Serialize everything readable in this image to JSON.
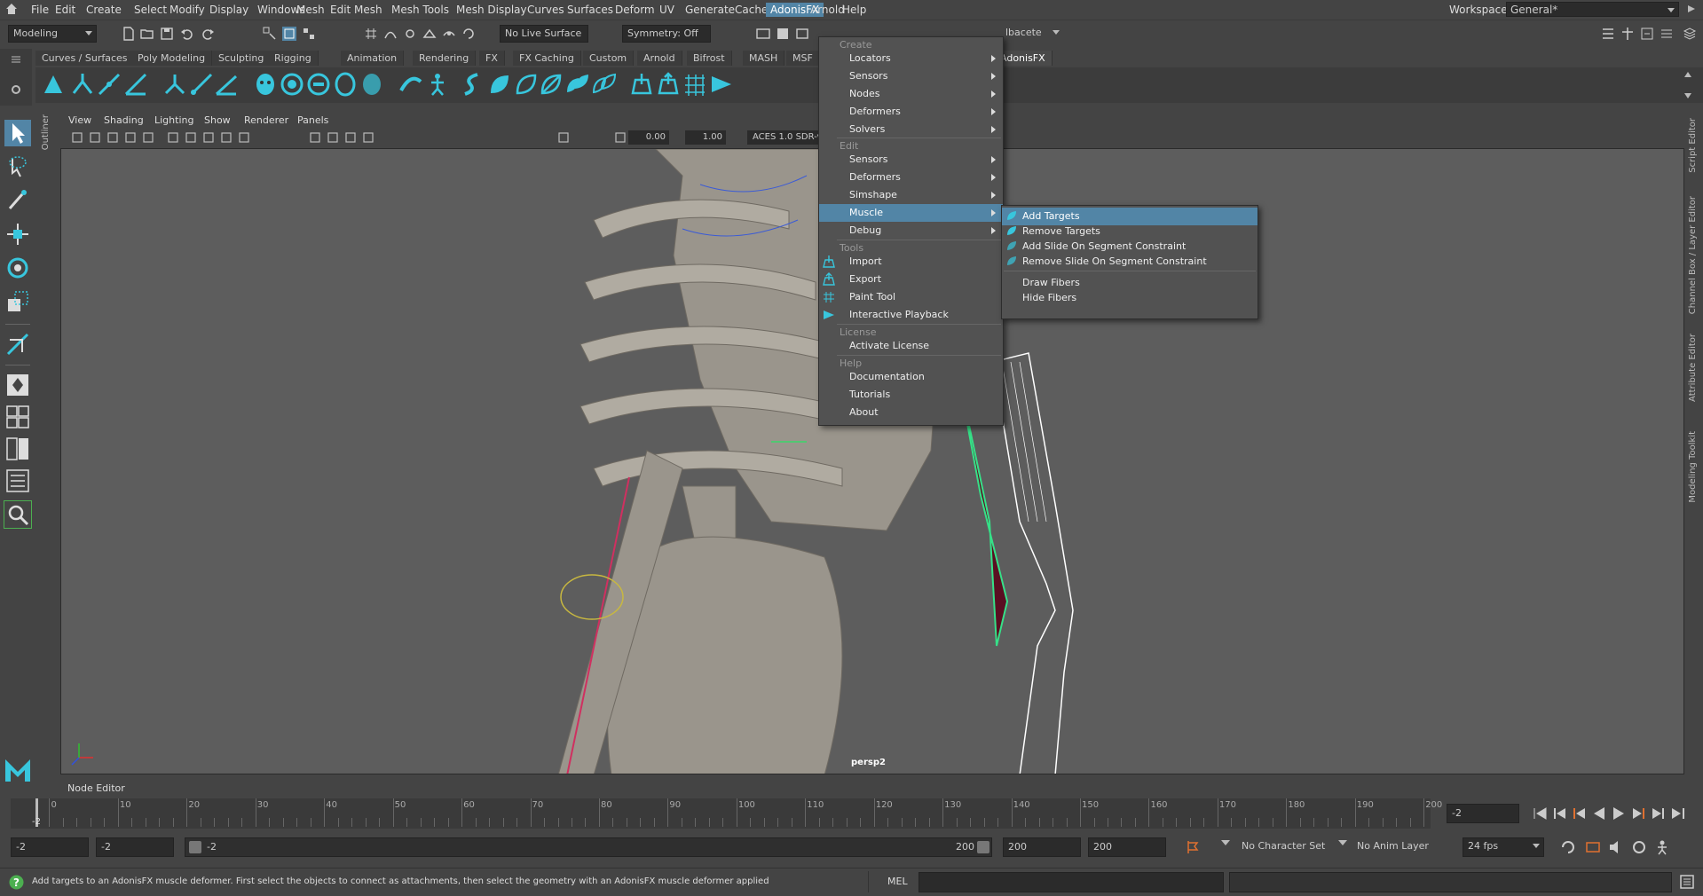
{
  "menubar": {
    "items": [
      "File",
      "Edit",
      "Create",
      "Select",
      "Modify",
      "Display",
      "Windows",
      "Mesh",
      "Edit Mesh",
      "Mesh Tools",
      "Mesh Display",
      "Curves",
      "Surfaces",
      "Deform",
      "UV",
      "Generate",
      "Cache",
      "AdonisFX",
      "Arnold",
      "Help"
    ],
    "active": "AdonisFX",
    "workspace_label": "Workspace:",
    "workspace_value": "General*"
  },
  "statusline": {
    "mode": "Modeling",
    "live_surface": "No Live Surface",
    "symmetry": "Symmetry: Off",
    "partial_field": "lbacete"
  },
  "shelf": {
    "tabs": [
      "Curves / Surfaces",
      "Poly Modeling",
      "Sculpting",
      "Rigging",
      "Animation",
      "Rendering",
      "FX",
      "FX Caching",
      "Custom",
      "Arnold",
      "Bifrost",
      "MASH",
      "MSF",
      "AdonisFX"
    ],
    "active_tab": "AdonisFX"
  },
  "outliner_label": "Outliner",
  "panel": {
    "menus": [
      "View",
      "Shading",
      "Lighting",
      "Show",
      "Renderer",
      "Panels"
    ],
    "exposure": "0.00",
    "gamma": "1.00",
    "colorspace": "ACES 1.0 SDR-v",
    "camera": "persp2"
  },
  "adonis_menu": {
    "sections": {
      "create": "Create",
      "edit": "Edit",
      "tools": "Tools",
      "license": "License",
      "help": "Help"
    },
    "create_items": [
      "Locators",
      "Sensors",
      "Nodes",
      "Deformers",
      "Solvers"
    ],
    "edit_items": [
      "Sensors",
      "Deformers",
      "Simshape",
      "Muscle",
      "Debug"
    ],
    "tools_items": [
      "Import",
      "Export",
      "Paint Tool",
      "Interactive Playback"
    ],
    "license_items": [
      "Activate License"
    ],
    "help_items": [
      "Documentation",
      "Tutorials",
      "About"
    ]
  },
  "muscle_submenu": {
    "items": [
      "Add Targets",
      "Remove Targets",
      "Add Slide On Segment Constraint",
      "Remove Slide On Segment Constraint",
      "Draw Fibers",
      "Hide Fibers"
    ],
    "highlighted": "Add Targets"
  },
  "right_tabs": [
    "Script Editor",
    "Channel Box / Layer Editor",
    "Attribute Editor",
    "Modeling Toolkit"
  ],
  "node_editor_label": "Node Editor",
  "timeline": {
    "ticks": [
      "0",
      "10",
      "20",
      "30",
      "40",
      "50",
      "60",
      "70",
      "80",
      "90",
      "100",
      "110",
      "120",
      "130",
      "140",
      "150",
      "160",
      "170",
      "180",
      "190",
      "200"
    ],
    "current_frame": "-2",
    "current_field": "-2"
  },
  "range": {
    "start": "-2",
    "playback_start": "-2",
    "slider_start": "-2",
    "slider_end": "200",
    "playback_end": "200",
    "end": "200",
    "character_set": "No Character Set",
    "anim_layer": "No Anim Layer",
    "fps": "24 fps"
  },
  "helpline": {
    "message": "Add targets to an AdonisFX muscle deformer. First select the objects to connect as attachments, then select the geometry with an AdonisFX muscle deformer applied",
    "mel_label": "MEL"
  },
  "colors": {
    "menu_highlight": "#5285a6",
    "viewport_bg": "#5d5d5d",
    "accent_cyan": "#38c6dd"
  }
}
